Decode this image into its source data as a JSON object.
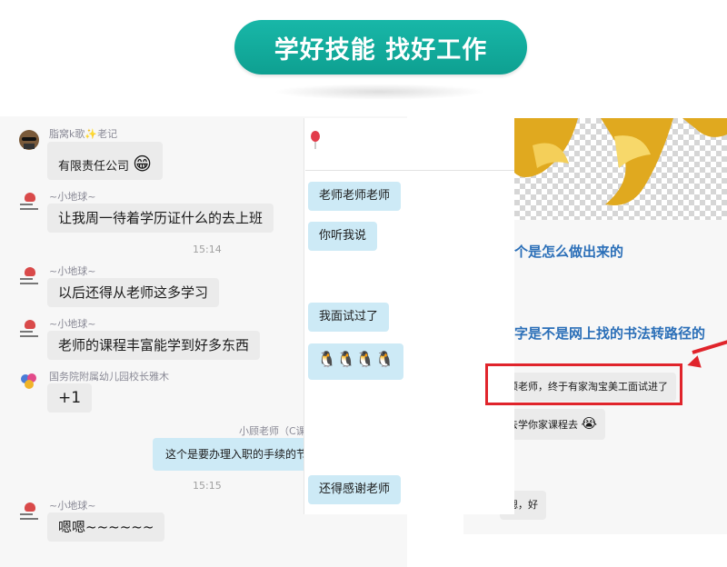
{
  "banner": {
    "title": "学好技能  找好工作"
  },
  "left_chat": {
    "messages": [
      {
        "sender": "脂窝k歌✨老记",
        "text": "有限责任公司",
        "emoji": "😁"
      },
      {
        "sender": "~小地球~",
        "text": "让我周一待着学历证什么的去上班"
      },
      {
        "time": "15:14"
      },
      {
        "sender": "~小地球~",
        "text": "以后还得从老师这多学习"
      },
      {
        "sender": "~小地球~",
        "text": "老师的课程丰富能学到好多东西"
      },
      {
        "sender": "国务院附属幼儿园校长雅木",
        "text": "+1"
      },
      {
        "sender": "小顾老师（C课",
        "text": "这个是要办理入职的手续的节"
      },
      {
        "time": "15:15"
      },
      {
        "sender": "~小地球~",
        "text": "嗯嗯~~~~~~"
      }
    ]
  },
  "middle_chat": {
    "header_icon": "balloon-icon",
    "messages": [
      {
        "text": "老师老师老师"
      },
      {
        "text": "你听我说"
      },
      {
        "text": "我面试过了"
      },
      {
        "text": "🐧🐧🐧🐧"
      },
      {
        "text": "还得感谢老师"
      }
    ]
  },
  "right_chat": {
    "link_1": "个是怎么做出来的",
    "link_2": "字是不是网上找的书法转路径的",
    "messages": [
      {
        "text": "顾老师，终于有家淘宝美工面试进了"
      },
      {
        "text": "去学你家课程去",
        "emoji": "😭"
      },
      {
        "text": "嗯，好"
      }
    ]
  },
  "colors": {
    "banner": "#12ab9c",
    "highlight_box": "#e0242b",
    "link": "#2b6fb8",
    "gold": "#e0a91f"
  }
}
